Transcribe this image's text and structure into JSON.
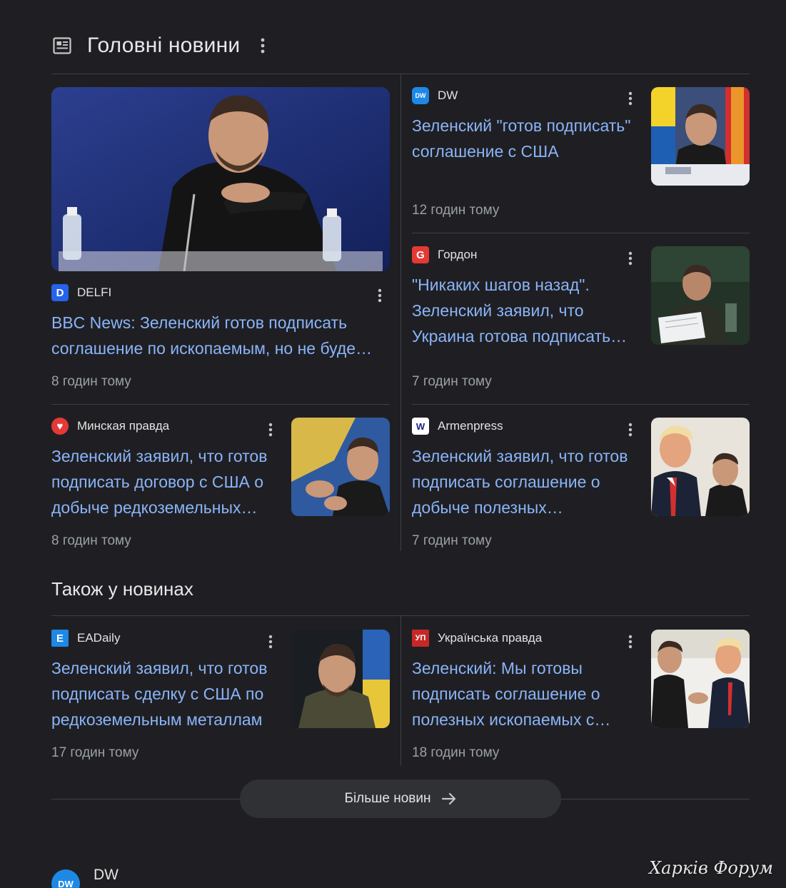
{
  "section": {
    "title": "Головні новини",
    "icon": "news-icon"
  },
  "cards": [
    {
      "source": "DELFI",
      "logo_text": "D",
      "logo_color": "#2563eb",
      "headline": "BBC News: Зеленский готов подписать соглашение по ископаемым, но не буде…",
      "time": "8 годин тому"
    },
    {
      "source": "DW",
      "logo_text": "DW",
      "logo_color": "#1e88e5",
      "headline": "Зеленский \"готов подписать\" соглашение с США",
      "time": "12 годин тому"
    },
    {
      "source": "Гордон",
      "logo_text": "G",
      "logo_color": "#e53935",
      "headline": "\"Никаких шагов назад\". Зеленский заявил, что Украина готова подписать…",
      "time": "7 годин тому"
    },
    {
      "source": "Минская правда",
      "logo_text": "♥",
      "logo_color": "#e53935",
      "headline": "Зеленский заявил, что готов подписать договор с США о добыче редкоземельных…",
      "time": "8 годин тому"
    },
    {
      "source": "Armenpress",
      "logo_text": "W",
      "logo_color": "#ffffff",
      "headline": "Зеленский заявил, что готов подписать соглашение о добыче полезных…",
      "time": "7 годин тому"
    }
  ],
  "also": {
    "title": "Також у новинах",
    "cards": [
      {
        "source": "EADaily",
        "logo_text": "E",
        "logo_color": "#1e88e5",
        "headline": "Зеленский заявил, что готов подписать сделку с США по редкоземельным металлам",
        "time": "17 годин тому"
      },
      {
        "source": "Українська правда",
        "logo_text": "УП",
        "logo_color": "#c62828",
        "headline": "Зеленский: Мы готовы подписать соглашение о полезных ископаемых с…",
        "time": "18 годин тому"
      }
    ]
  },
  "more_button": {
    "label": "Більше новин"
  },
  "bottom": {
    "source": "DW",
    "logo_text": "DW"
  },
  "watermark": "Харків Форум",
  "colors": {
    "background": "#1f1f23",
    "link": "#8ab4f8",
    "muted": "#9aa0a6",
    "divider": "#3c4043"
  }
}
